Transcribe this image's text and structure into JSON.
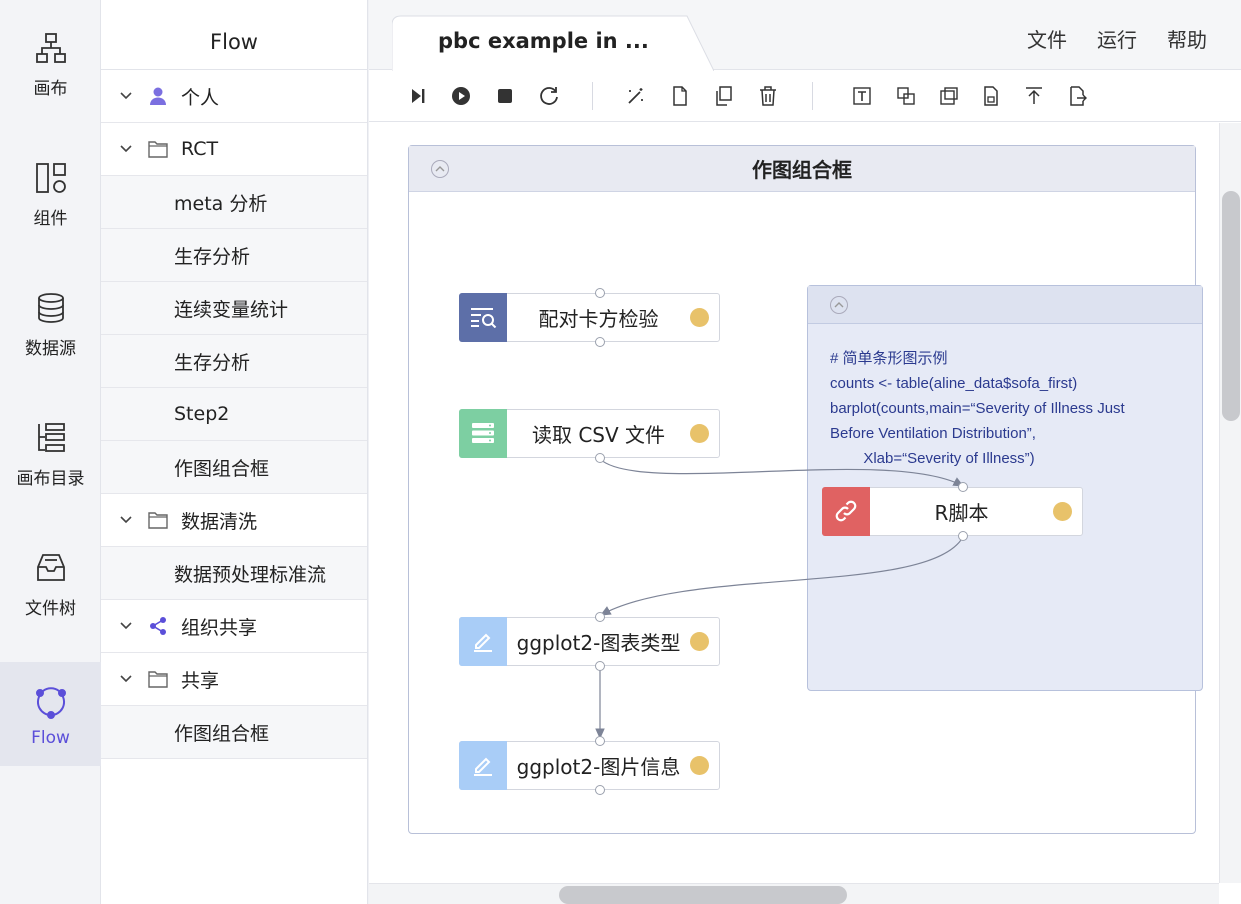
{
  "rail": {
    "items": [
      {
        "label": "画布",
        "icon": "canvas-icon"
      },
      {
        "label": "组件",
        "icon": "components-icon"
      },
      {
        "label": "数据源",
        "icon": "database-icon"
      },
      {
        "label": "画布目录",
        "icon": "catalog-icon"
      },
      {
        "label": "文件树",
        "icon": "file-tree-icon"
      },
      {
        "label": "Flow",
        "icon": "flow-icon"
      }
    ],
    "active": "Flow"
  },
  "tree": {
    "title": "Flow",
    "rows": [
      {
        "label": "个人",
        "kind": "group",
        "icon": "user-icon"
      },
      {
        "label": "RCT",
        "kind": "group",
        "icon": "folder-icon"
      },
      {
        "label": "meta 分析",
        "kind": "child"
      },
      {
        "label": "生存分析",
        "kind": "child"
      },
      {
        "label": "连续变量统计",
        "kind": "child"
      },
      {
        "label": "生存分析",
        "kind": "child"
      },
      {
        "label": "Step2",
        "kind": "child"
      },
      {
        "label": "作图组合框",
        "kind": "child"
      },
      {
        "label": "数据清洗",
        "kind": "group",
        "icon": "folder-icon"
      },
      {
        "label": "数据预处理标准流",
        "kind": "child"
      },
      {
        "label": "组织共享",
        "kind": "group",
        "icon": "share-icon"
      },
      {
        "label": "共享",
        "kind": "group",
        "icon": "folder-icon"
      },
      {
        "label": "作图组合框",
        "kind": "child"
      }
    ]
  },
  "tab": {
    "label": "pbc example in ..."
  },
  "menu": {
    "file": "文件",
    "run": "运行",
    "help": "帮助"
  },
  "frame": {
    "title": "作图组合框"
  },
  "script_note": {
    "lines": [
      "# 简单条形图示例",
      "counts <- table(aline_data$sofa_first)",
      "barplot(counts,main=“Severity of Illness Just",
      "Before Ventilation Distribution”,",
      "        Xlab=“Severity of Illness”)"
    ]
  },
  "nodes": {
    "chi": {
      "label": "配对卡方检验",
      "icon_color": "#5d6fa8"
    },
    "csv": {
      "label": "读取 CSV 文件",
      "icon_color": "#7dcfa2"
    },
    "rscript": {
      "label": "R脚本",
      "icon_color": "#e06262"
    },
    "chart_type": {
      "label": "ggplot2-图表类型",
      "icon_color": "#a9cdf7"
    },
    "image_info": {
      "label": "ggplot2-图片信息",
      "icon_color": "#a9cdf7"
    }
  },
  "colors": {
    "accent": "#5b4fd9",
    "status_dot": "#e8c26a"
  }
}
